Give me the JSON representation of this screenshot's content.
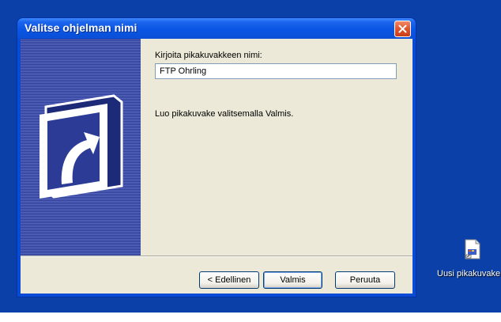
{
  "window": {
    "title": "Valitse ohjelman nimi",
    "close_icon": "close-icon"
  },
  "content": {
    "name_label": "Kirjoita pikakuvakkeen nimi:",
    "name_value": "FTP Ohrling",
    "instruction": "Luo pikakuvake valitsemalla Valmis."
  },
  "buttons": {
    "back": "< Edellinen",
    "finish": "Valmis",
    "cancel": "Peruuta"
  },
  "sidebar": {
    "icon": "shortcut-arrow-icon"
  },
  "desktop": {
    "icon_label": "Uusi pikakuvake",
    "icon": "shortcut-file-icon",
    "background_color": "#0b40a8"
  },
  "colors": {
    "titlebar": "#0a56e4",
    "dialog_bg": "#ece9d8",
    "close_button": "#e0542d"
  }
}
